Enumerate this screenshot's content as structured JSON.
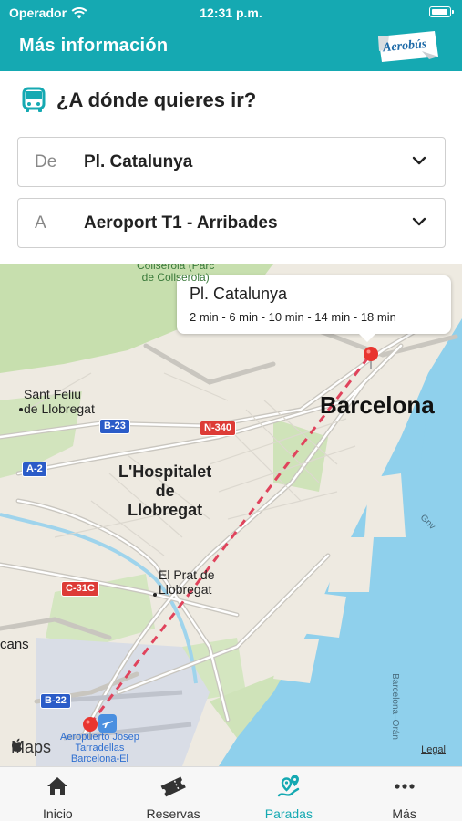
{
  "status_bar": {
    "carrier": "Operador",
    "time": "12:31 p.m."
  },
  "header": {
    "title": "Más información",
    "logo_text": "Aerobús"
  },
  "destination": {
    "title": "¿A dónde quieres ir?",
    "from_label": "De",
    "from_value": "Pl. Catalunya",
    "to_label": "A",
    "to_value": "Aeroport T1 - Arribades"
  },
  "map": {
    "tooltip_title": "Pl. Catalunya",
    "tooltip_schedule": "2 min - 6 min - 10 min - 14 min - 18 min",
    "labels": {
      "barcelona": "Barcelona",
      "hospitalet": "L'Hospitalet\nde\nLlobregat",
      "sant_feliu": "Sant Feliu\nde Llobregat",
      "el_prat": "El Prat de\nLlobregat",
      "cans": "cans",
      "collserola": "Collserola (Parc\nde Collserola)",
      "airport": "Aeropuerto Josep\nTarradellas\nBarcelona-El",
      "gnv": "Gnv",
      "ferry": "Barcelona–Orán"
    },
    "shields": {
      "b23": "B-23",
      "n340": "N-340",
      "a2": "A-2",
      "c31c": "C-31C",
      "b22": "B-22"
    },
    "brand": "Maps",
    "legal": "Legal",
    "colors": {
      "water": "#8fd0ec",
      "land": "#eeeae1",
      "park": "#c7dfae",
      "route": "#e0435c",
      "pin": "#e8352f"
    }
  },
  "tabbar": {
    "items": [
      {
        "label": "Inicio",
        "icon": "home-icon"
      },
      {
        "label": "Reservas",
        "icon": "ticket-icon"
      },
      {
        "label": "Paradas",
        "icon": "stops-icon"
      },
      {
        "label": "Más",
        "icon": "more-icon"
      }
    ],
    "active_index": 2,
    "active_color": "#15a9b2"
  }
}
